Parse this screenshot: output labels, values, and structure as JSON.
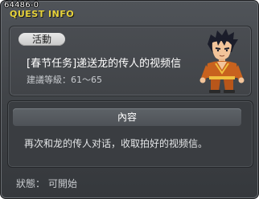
{
  "window": {
    "id_label": "64486-0",
    "title": "QUEST INFO"
  },
  "quest": {
    "category": "活動",
    "name": "[春节任务]递送龙的传人的视频信",
    "level_range": "建議等級：61～65",
    "npc": "npc-portrait"
  },
  "content": {
    "header": "內容",
    "text": "再次和龙的传人对话，收取拍好的视频信。"
  },
  "status": {
    "text": "狀態： 可開始"
  },
  "colors": {
    "title": "#e6d23a",
    "panel": "#414448"
  }
}
